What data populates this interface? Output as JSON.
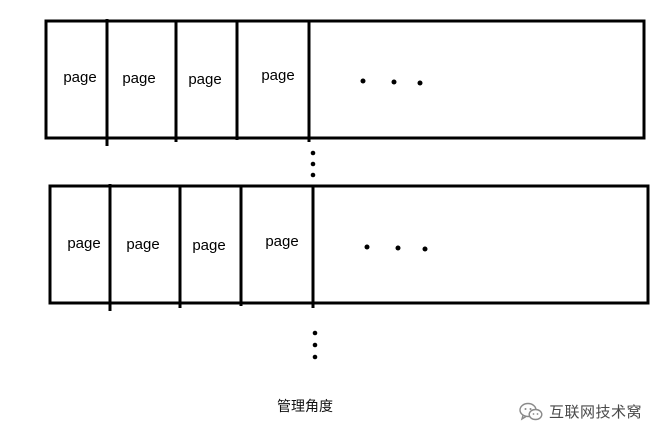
{
  "diagram": {
    "rows": [
      {
        "pages": [
          "page",
          "page",
          "page",
          "page"
        ],
        "continuation": "• • •"
      },
      {
        "pages": [
          "page",
          "page",
          "page",
          "page"
        ],
        "continuation": "• • •"
      }
    ],
    "caption": "管理角度"
  },
  "watermark": {
    "text": "互联网技术窝",
    "icon": "wechat-icon"
  }
}
